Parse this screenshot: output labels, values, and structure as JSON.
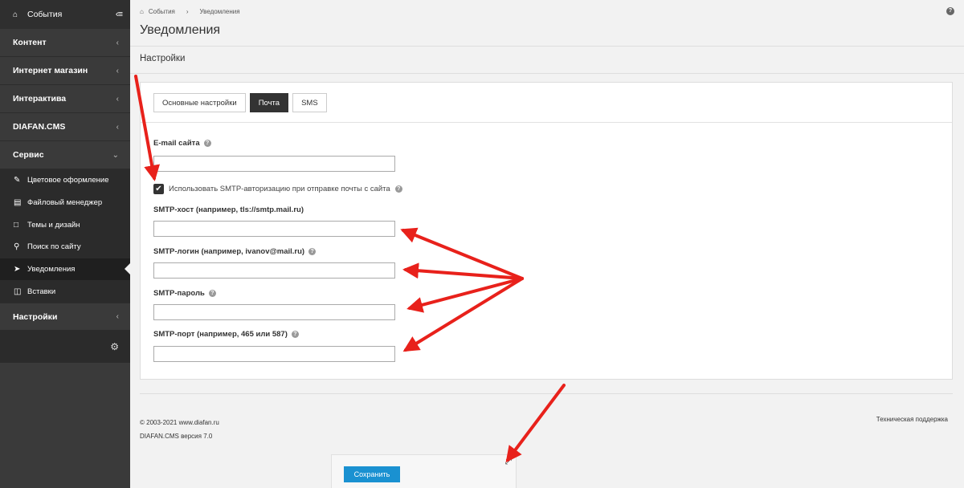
{
  "sidebar": {
    "top_label": "События",
    "sections": [
      {
        "label": "Контент"
      },
      {
        "label": "Интернет магазин"
      },
      {
        "label": "Интерактива"
      },
      {
        "label": "DIAFAN.CMS"
      },
      {
        "label": "Сервис"
      }
    ],
    "service_items": [
      {
        "label": "Цветовое оформление",
        "icon": "brush-icon"
      },
      {
        "label": "Файловый менеджер",
        "icon": "file-icon"
      },
      {
        "label": "Темы и дизайн",
        "icon": "document-icon"
      },
      {
        "label": "Поиск по сайту",
        "icon": "search-icon"
      },
      {
        "label": "Уведомления",
        "icon": "paper-plane-icon"
      },
      {
        "label": "Вставки",
        "icon": "paste-icon"
      }
    ],
    "settings_label": "Настройки"
  },
  "breadcrumb": {
    "home": "События",
    "current": "Уведомления"
  },
  "page": {
    "title": "Уведомления",
    "section_title": "Настройки"
  },
  "tabs": [
    {
      "label": "Основные настройки"
    },
    {
      "label": "Почта"
    },
    {
      "label": "SMS"
    }
  ],
  "form": {
    "email_label": "E-mail сайта",
    "email_value": "",
    "smtp_checkbox_label": "Использовать SMTP-авторизацию при отправке почты с сайта",
    "smtp_checked": true,
    "smtp_host_label": "SMTP-хост (например, tls://smtp.mail.ru)",
    "smtp_host_value": "",
    "smtp_login_label": "SMTP-логин (например, ivanov@mail.ru)",
    "smtp_login_value": "",
    "smtp_password_label": "SMTP-пароль",
    "smtp_password_value": "",
    "smtp_port_label": "SMTP-порт (например, 465 или 587)",
    "smtp_port_value": ""
  },
  "footer": {
    "copyright": "© 2003-2021 www.diafan.ru",
    "version": "DIAFAN.CMS версия 7.0",
    "support": "Техническая поддержка"
  },
  "save_label": "Сохранить",
  "colors": {
    "sidebar": "#3a3a3a",
    "accent": "#1a91d1",
    "arrow": "#e8211b"
  }
}
